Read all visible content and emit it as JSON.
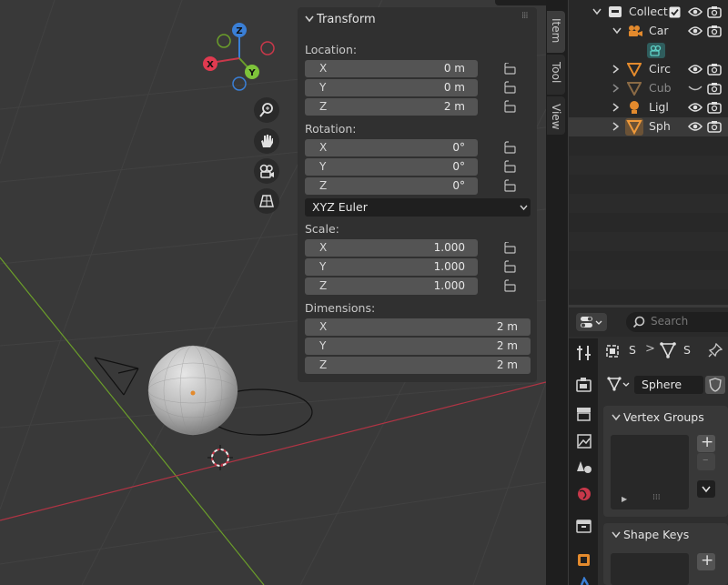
{
  "viewport": {
    "gizmo": {
      "x": "X",
      "y": "Y",
      "z": "Z"
    },
    "nav_buttons": [
      "zoom-icon",
      "pan-hand-icon",
      "camera-view-icon",
      "grid-perspective-icon"
    ]
  },
  "npanel": {
    "title": "Transform",
    "location_label": "Location:",
    "location": [
      {
        "axis": "X",
        "value": "0 m"
      },
      {
        "axis": "Y",
        "value": "0 m"
      },
      {
        "axis": "Z",
        "value": "2 m"
      }
    ],
    "rotation_label": "Rotation:",
    "rotation": [
      {
        "axis": "X",
        "value": "0°"
      },
      {
        "axis": "Y",
        "value": "0°"
      },
      {
        "axis": "Z",
        "value": "0°"
      }
    ],
    "rotation_mode": "XYZ Euler",
    "scale_label": "Scale:",
    "scale": [
      {
        "axis": "X",
        "value": "1.000"
      },
      {
        "axis": "Y",
        "value": "1.000"
      },
      {
        "axis": "Z",
        "value": "1.000"
      }
    ],
    "dimensions_label": "Dimensions:",
    "dimensions": [
      {
        "axis": "X",
        "value": "2 m"
      },
      {
        "axis": "Y",
        "value": "2 m"
      },
      {
        "axis": "Z",
        "value": "2 m"
      }
    ]
  },
  "tabs": [
    "Item",
    "Tool",
    "View"
  ],
  "outliner": {
    "rows": [
      {
        "label": "Collect",
        "icon": "collection-icon"
      },
      {
        "label": "Car",
        "icon": "camera-object-icon"
      },
      {
        "label": "",
        "icon": "camera-data-icon"
      },
      {
        "label": "Circ",
        "icon": "mesh-object-icon"
      },
      {
        "label": "Cub",
        "icon": "mesh-object-icon"
      },
      {
        "label": "Ligl",
        "icon": "light-object-icon"
      },
      {
        "label": "Sph",
        "icon": "mesh-object-icon"
      }
    ]
  },
  "properties": {
    "search_placeholder": "Search",
    "breadcrumb": {
      "scene": "S",
      "object": "S"
    },
    "object_name": "Sphere",
    "vertex_groups_title": "Vertex Groups",
    "shape_keys_title": "Shape Keys"
  },
  "colors": {
    "x_axis": "#c9384a",
    "y_axis": "#6b9e2a",
    "z_axis": "#3a7fd6",
    "orange": "#e38a2d"
  }
}
